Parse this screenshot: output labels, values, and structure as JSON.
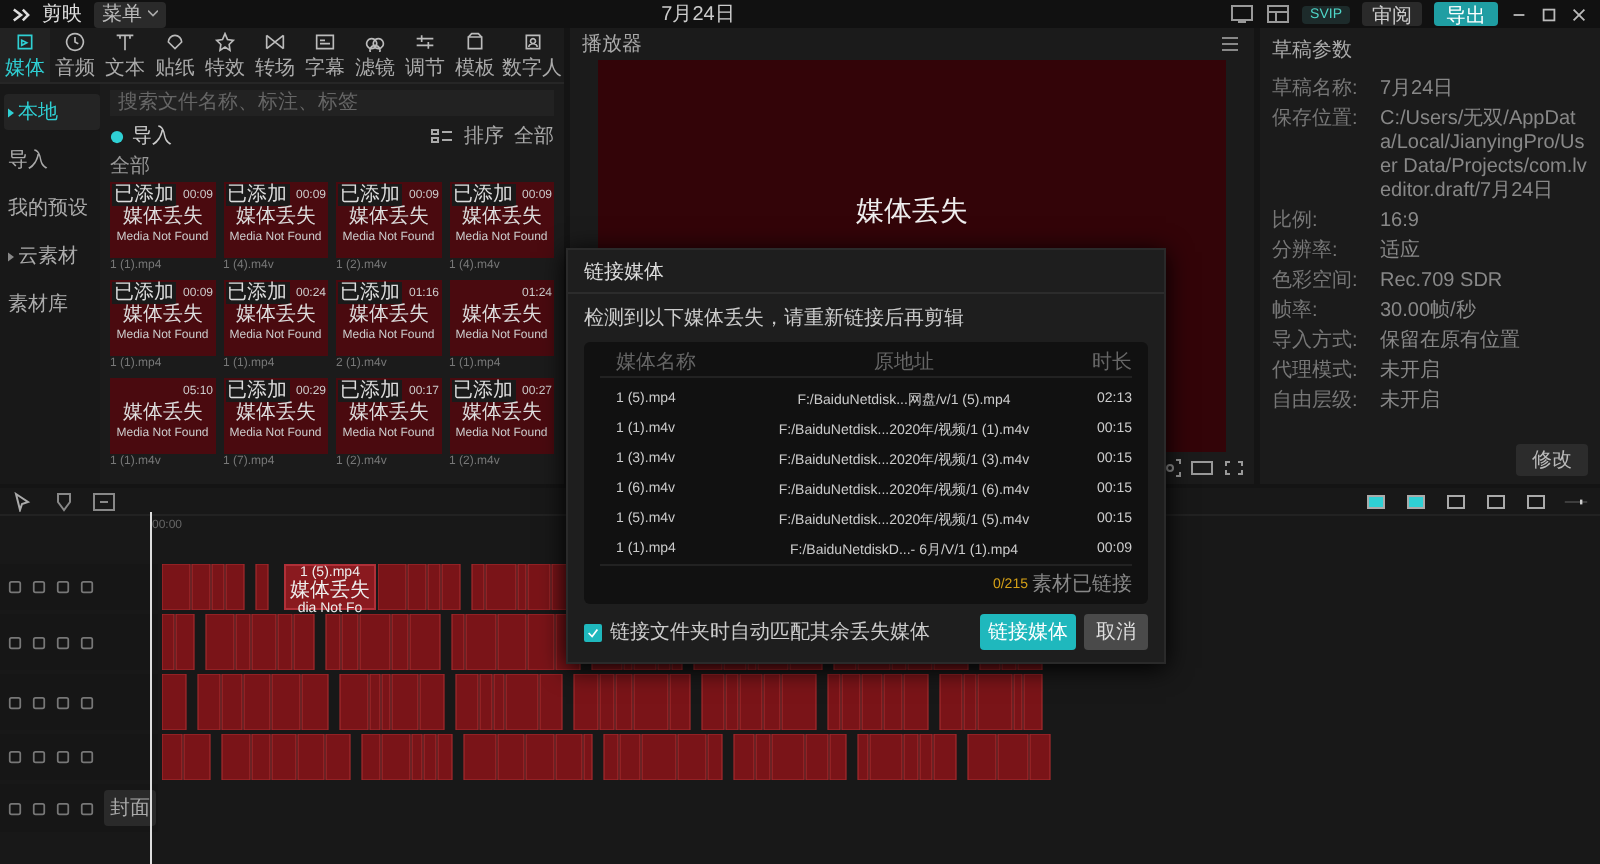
{
  "topbar": {
    "app_name": "剪映",
    "menu": "菜单",
    "title": "7月24日",
    "svip": "SVIP",
    "review": "审阅",
    "export": "导出"
  },
  "tools": [
    {
      "label": "媒体",
      "selected": true
    },
    {
      "label": "音频",
      "selected": false
    },
    {
      "label": "文本",
      "selected": false
    },
    {
      "label": "贴纸",
      "selected": false
    },
    {
      "label": "特效",
      "selected": false
    },
    {
      "label": "转场",
      "selected": false
    },
    {
      "label": "字幕",
      "selected": false
    },
    {
      "label": "滤镜",
      "selected": false
    },
    {
      "label": "调节",
      "selected": false
    },
    {
      "label": "模板",
      "selected": false
    },
    {
      "label": "数字人",
      "selected": false
    }
  ],
  "sidebar": [
    {
      "label": "本地",
      "kind": "group",
      "selected": true
    },
    {
      "label": "导入",
      "kind": "item",
      "selected": false
    },
    {
      "label": "我的预设",
      "kind": "item",
      "selected": false
    },
    {
      "label": "云素材",
      "kind": "group",
      "selected": false
    },
    {
      "label": "素材库",
      "kind": "item",
      "selected": false
    }
  ],
  "media": {
    "search_placeholder": "搜索文件名称、标注、标签",
    "import": "导入",
    "sort": "排序",
    "filter": "全部",
    "section": "全部",
    "items": [
      {
        "added": true,
        "badge": "已添加",
        "duration": "00:09",
        "title": "媒体丢失",
        "subtitle": "Media Not Found",
        "file": "1 (1).mp4"
      },
      {
        "added": true,
        "badge": "已添加",
        "duration": "00:09",
        "title": "媒体丢失",
        "subtitle": "Media Not Found",
        "file": "1 (4).m4v"
      },
      {
        "added": true,
        "badge": "已添加",
        "duration": "00:09",
        "title": "媒体丢失",
        "subtitle": "Media Not Found",
        "file": "1 (2).m4v"
      },
      {
        "added": true,
        "badge": "已添加",
        "duration": "00:09",
        "title": "媒体丢失",
        "subtitle": "Media Not Found",
        "file": "1 (4).m4v"
      },
      {
        "added": true,
        "badge": "已添加",
        "duration": "00:09",
        "title": "媒体丢失",
        "subtitle": "Media Not Found",
        "file": "1 (1).mp4"
      },
      {
        "added": true,
        "badge": "已添加",
        "duration": "00:24",
        "title": "媒体丢失",
        "subtitle": "Media Not Found",
        "file": "1 (1).mp4"
      },
      {
        "added": true,
        "badge": "已添加",
        "duration": "01:16",
        "title": "媒体丢失",
        "subtitle": "Media Not Found",
        "file": "2 (1).m4v"
      },
      {
        "added": false,
        "duration": "01:24",
        "title": "媒体丢失",
        "subtitle": "Media Not Found",
        "file": "1 (1).mp4"
      },
      {
        "added": false,
        "duration": "05:10",
        "title": "媒体丢失",
        "subtitle": "Media Not Found",
        "file": "1 (1).m4v"
      },
      {
        "added": true,
        "badge": "已添加",
        "duration": "00:29",
        "title": "媒体丢失",
        "subtitle": "Media Not Found",
        "file": "1 (7).mp4"
      },
      {
        "added": true,
        "badge": "已添加",
        "duration": "00:17",
        "title": "媒体丢失",
        "subtitle": "Media Not Found",
        "file": "1 (2).m4v"
      },
      {
        "added": true,
        "badge": "已添加",
        "duration": "00:27",
        "title": "媒体丢失",
        "subtitle": "Media Not Found",
        "file": "1 (2).m4v"
      }
    ]
  },
  "player": {
    "title": "播放器",
    "message": "媒体丢失"
  },
  "draft": {
    "title": "草稿参数",
    "rows": [
      {
        "label": "草稿名称:",
        "value": "7月24日"
      },
      {
        "label": "保存位置:",
        "value": "C:/Users/无双/AppData/Local/JianyingPro/User Data/Projects/com.lveditor.draft/7月24日"
      },
      {
        "label": "比例:",
        "value": "16:9"
      },
      {
        "label": "分辨率:",
        "value": "适应"
      },
      {
        "label": "色彩空间:",
        "value": "Rec.709 SDR"
      },
      {
        "label": "帧率:",
        "value": "30.00帧/秒"
      },
      {
        "label": "导入方式:",
        "value": "保留在原有位置"
      },
      {
        "label": "代理模式:",
        "value": "未开启"
      },
      {
        "label": "自由层级:",
        "value": "未开启"
      }
    ],
    "modify": "修改"
  },
  "timeline": {
    "ruler": "00:00",
    "tracks": [
      {
        "kind": "clips",
        "clip": {
          "name": "1 (5).mp4",
          "status": "媒体丢失",
          "note": "dia Not Fo"
        }
      },
      {
        "kind": "clips"
      },
      {
        "kind": "clips"
      },
      {
        "kind": "clips"
      },
      {
        "kind": "cover",
        "cover": "封面"
      }
    ]
  },
  "dialog": {
    "title": "链接媒体",
    "message": "检测到以下媒体丢失，请重新链接后再剪辑",
    "columns": [
      "媒体名称",
      "原地址",
      "时长"
    ],
    "rows": [
      {
        "name": "1 (5).mp4",
        "path": "F:/BaiduNetdisk...网盘/v/1 (5).mp4",
        "duration": "02:13"
      },
      {
        "name": "1 (1).m4v",
        "path": "F:/BaiduNetdisk...2020年/视频/1 (1).m4v",
        "duration": "00:15"
      },
      {
        "name": "1 (3).m4v",
        "path": "F:/BaiduNetdisk...2020年/视频/1 (3).m4v",
        "duration": "00:15"
      },
      {
        "name": "1 (6).m4v",
        "path": "F:/BaiduNetdisk...2020年/视频/1 (6).m4v",
        "duration": "00:15"
      },
      {
        "name": "1 (5).m4v",
        "path": "F:/BaiduNetdisk...2020年/视频/1 (5).m4v",
        "duration": "00:15"
      },
      {
        "name": "1 (1).mp4",
        "path": "F:/BaiduNetdiskD...- 6月/V/1 (1).mp4",
        "duration": "00:09"
      }
    ],
    "linked_count": "0/215",
    "linked_text": "素材已链接",
    "auto_match": {
      "label": "链接文件夹时自动匹配其余丢失媒体",
      "checked": true
    },
    "link": "链接媒体",
    "cancel": "取消"
  }
}
